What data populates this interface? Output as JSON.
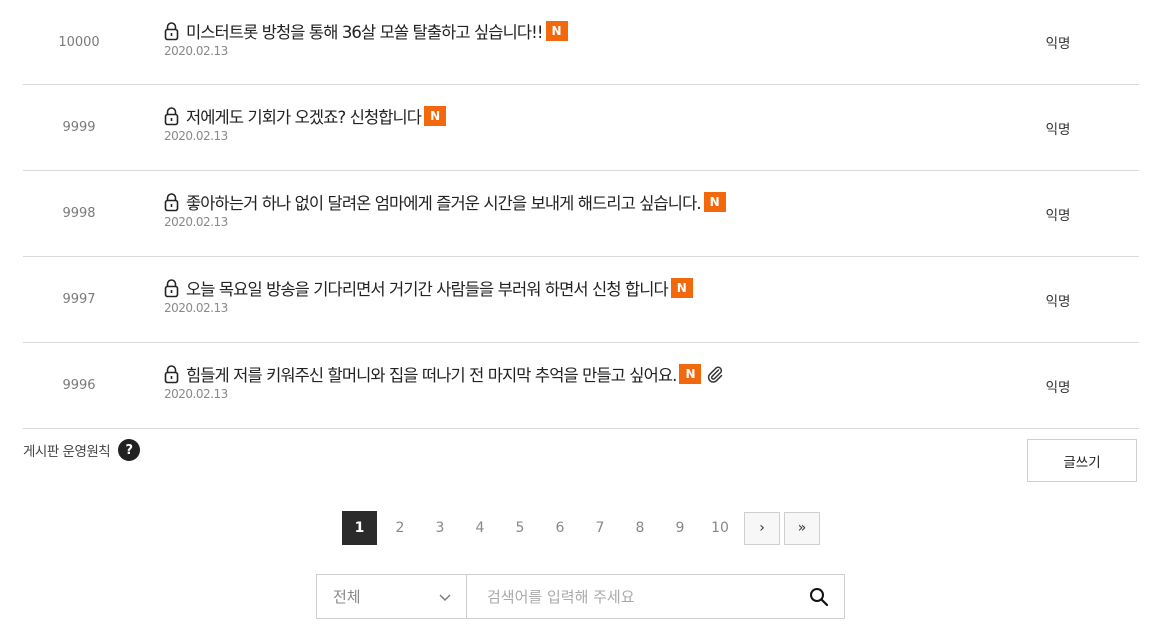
{
  "posts": [
    {
      "number": "10000",
      "title": "미스터트롯 방청을 통해 36살 모쏠 탈출하고 싶습니다!!",
      "badge": "N",
      "date": "2020.02.13",
      "author": "익명",
      "attachment": false
    },
    {
      "number": "9999",
      "title": "저에게도 기회가 오겠죠? 신청합니다",
      "badge": "N",
      "date": "2020.02.13",
      "author": "익명",
      "attachment": false
    },
    {
      "number": "9998",
      "title": "좋아하는거 하나 없이 달려온 엄마에게 즐거운 시간을 보내게 해드리고 싶습니다.",
      "badge": "N",
      "date": "2020.02.13",
      "author": "익명",
      "attachment": false
    },
    {
      "number": "9997",
      "title": "오늘 목요일 방송을 기다리면서 거기간 사람들을 부러워 하면서 신청 합니다",
      "badge": "N",
      "date": "2020.02.13",
      "author": "익명",
      "attachment": false
    },
    {
      "number": "9996",
      "title": "힘들게 저를 키워주신 할머니와 집을 떠나기 전 마지막 추억을 만들고 싶어요.",
      "badge": "N",
      "date": "2020.02.13",
      "author": "익명",
      "attachment": true
    }
  ],
  "board_rules": {
    "label": "게시판 운영원칙",
    "help_glyph": "?"
  },
  "write_button": {
    "label": "글쓰기"
  },
  "pagination": {
    "current": "1",
    "pages": [
      "1",
      "2",
      "3",
      "4",
      "5",
      "6",
      "7",
      "8",
      "9",
      "10"
    ],
    "next_glyph": "›",
    "last_glyph": "»"
  },
  "search": {
    "scope_value": "전체",
    "placeholder": "검색어를 입력해 주세요"
  },
  "colors": {
    "new_badge": "#f2680d",
    "active_page": "#2b2b2b"
  },
  "icons": {
    "lock": "lock-icon",
    "new": "new-badge",
    "attachment": "paperclip-icon",
    "help": "question-icon",
    "dropdown": "chevron-down-icon",
    "search": "search-icon"
  }
}
